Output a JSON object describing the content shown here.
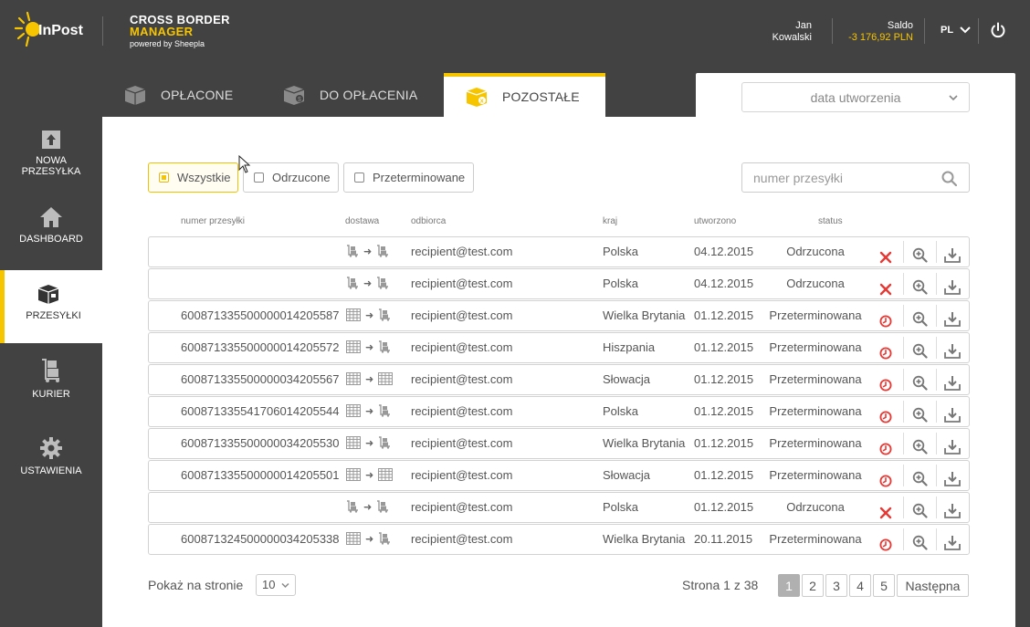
{
  "header": {
    "logo_text": "InPost",
    "brand_line1": "CROSS BORDER",
    "brand_line2": "MANAGER",
    "brand_line3": "powered by Sheepla",
    "user_first": "Jan",
    "user_last": "Kowalski",
    "saldo_label": "Saldo",
    "saldo_value": "-3 176,92 PLN",
    "language": "PL"
  },
  "sidebar": {
    "items": [
      {
        "label_l1": "NOWA",
        "label_l2": "PRZESYŁKA",
        "icon": "upload-box-icon"
      },
      {
        "label_l1": "DASHBOARD",
        "label_l2": "",
        "icon": "home-icon"
      },
      {
        "label_l1": "PRZESYŁKI",
        "label_l2": "",
        "icon": "parcels-icon"
      },
      {
        "label_l1": "KURIER",
        "label_l2": "",
        "icon": "courier-trolley-icon"
      },
      {
        "label_l1": "USTAWIENIA",
        "label_l2": "",
        "icon": "gear-icon"
      }
    ],
    "active": "PRZESYŁKI"
  },
  "tabs": [
    {
      "label": "OPŁACONE",
      "icon": "paid-box-icon"
    },
    {
      "label": "DO OPŁACENIA",
      "icon": "to-pay-box-icon"
    },
    {
      "label": "POZOSTAŁE",
      "icon": "other-box-icon"
    }
  ],
  "date_select": {
    "value": "data utworzenia"
  },
  "filters": [
    {
      "label": "Wszystkie",
      "checked": true
    },
    {
      "label": "Odrzucone",
      "checked": false
    },
    {
      "label": "Przeterminowane",
      "checked": false
    }
  ],
  "search": {
    "placeholder": "numer przesyłki"
  },
  "columns": {
    "number": "numer przesyłki",
    "delivery": "dostawa",
    "recipient": "odbiorca",
    "country": "kraj",
    "created": "utworzono",
    "status": "status"
  },
  "rows": [
    {
      "number": "",
      "from": "courier",
      "to": "courier",
      "recipient": "recipient@test.com",
      "country": "Polska",
      "date": "04.12.2015",
      "status": "Odrzucona",
      "kind": "rejected"
    },
    {
      "number": "",
      "from": "courier",
      "to": "courier",
      "recipient": "recipient@test.com",
      "country": "Polska",
      "date": "04.12.2015",
      "status": "Odrzucona",
      "kind": "rejected"
    },
    {
      "number": "600871335500000014205587",
      "from": "locker",
      "to": "courier",
      "recipient": "recipient@test.com",
      "country": "Wielka Brytania",
      "date": "01.12.2015",
      "status": "Przeterminowana",
      "kind": "expired"
    },
    {
      "number": "600871335500000014205572",
      "from": "locker",
      "to": "courier",
      "recipient": "recipient@test.com",
      "country": "Hiszpania",
      "date": "01.12.2015",
      "status": "Przeterminowana",
      "kind": "expired"
    },
    {
      "number": "600871335500000034205567",
      "from": "locker",
      "to": "locker",
      "recipient": "recipient@test.com",
      "country": "Słowacja",
      "date": "01.12.2015",
      "status": "Przeterminowana",
      "kind": "expired"
    },
    {
      "number": "600871335541706014205544",
      "from": "locker",
      "to": "courier",
      "recipient": "recipient@test.com",
      "country": "Polska",
      "date": "01.12.2015",
      "status": "Przeterminowana",
      "kind": "expired"
    },
    {
      "number": "600871335500000034205530",
      "from": "locker",
      "to": "courier",
      "recipient": "recipient@test.com",
      "country": "Wielka Brytania",
      "date": "01.12.2015",
      "status": "Przeterminowana",
      "kind": "expired"
    },
    {
      "number": "600871335500000014205501",
      "from": "locker",
      "to": "locker",
      "recipient": "recipient@test.com",
      "country": "Słowacja",
      "date": "01.12.2015",
      "status": "Przeterminowana",
      "kind": "expired"
    },
    {
      "number": "",
      "from": "courier",
      "to": "courier",
      "recipient": "recipient@test.com",
      "country": "Polska",
      "date": "01.12.2015",
      "status": "Odrzucona",
      "kind": "rejected"
    },
    {
      "number": "600871324500000034205338",
      "from": "locker",
      "to": "courier",
      "recipient": "recipient@test.com",
      "country": "Wielka Brytania",
      "date": "20.11.2015",
      "status": "Przeterminowana",
      "kind": "expired"
    }
  ],
  "footer": {
    "per_page_label": "Pokaż na stronie",
    "per_page_value": "10",
    "page_info": "Strona 1 z 38",
    "pages": [
      "1",
      "2",
      "3",
      "4",
      "5"
    ],
    "current_page": "1",
    "next_label": "Następna"
  },
  "colors": {
    "accent": "#f7c500",
    "sidebar_bg": "#424242",
    "error_red": "#e53935"
  }
}
